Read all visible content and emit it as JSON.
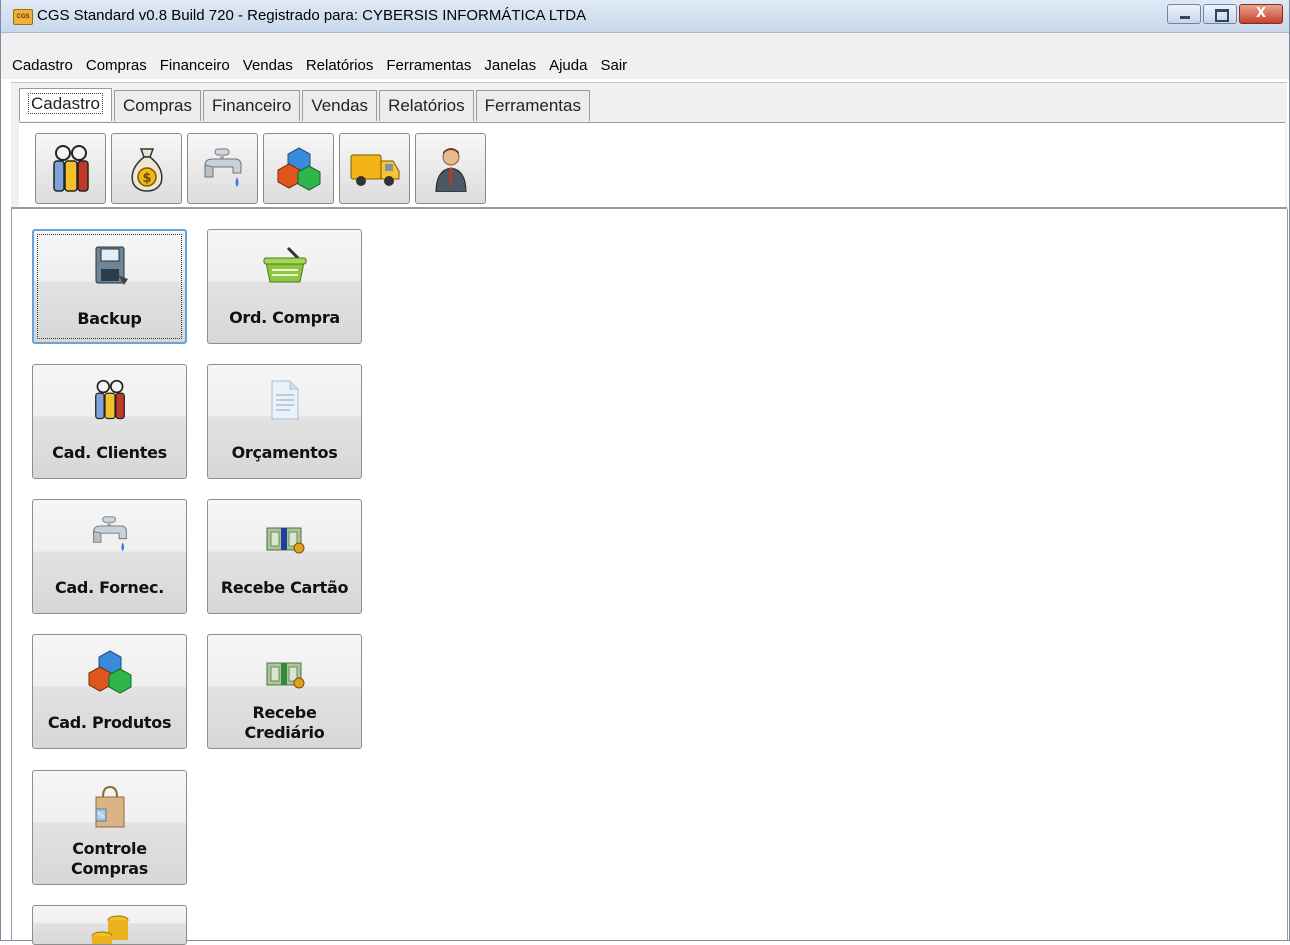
{
  "window": {
    "title": "CGS Standard v0.8 Build 720 - Registrado para: CYBERSIS INFORMÁTICA LTDA",
    "app_icon_text": "CGS",
    "close_glyph": "X"
  },
  "menu": [
    "Cadastro",
    "Compras",
    "Financeiro",
    "Vendas",
    "Relatórios",
    "Ferramentas",
    "Janelas",
    "Ajuda",
    "Sair"
  ],
  "tabs": [
    "Cadastro",
    "Compras",
    "Financeiro",
    "Vendas",
    "Relatórios",
    "Ferramentas"
  ],
  "active_tab": "Cadastro",
  "toolbar_icons": [
    "clients-icon",
    "money-bag-icon",
    "faucet-icon",
    "cubes-icon",
    "truck-icon",
    "user-icon"
  ],
  "buttons": {
    "backup": "Backup",
    "ord_compra": "Ord. Compra",
    "cad_clientes": "Cad. Clientes",
    "orcamentos": "Orçamentos",
    "cad_fornec": "Cad. Fornec.",
    "recebe_cartao": "Recebe Cartão",
    "cad_produtos": "Cad. Produtos",
    "recebe_crediario_1": "Recebe",
    "recebe_crediario_2": "Crediário",
    "controle_compras_1": "Controle",
    "controle_compras_2": "Compras"
  },
  "colors": {
    "titlebar": "#c9d8ec",
    "focus_border": "#6aa2d6",
    "close_button": "#c5412b"
  }
}
